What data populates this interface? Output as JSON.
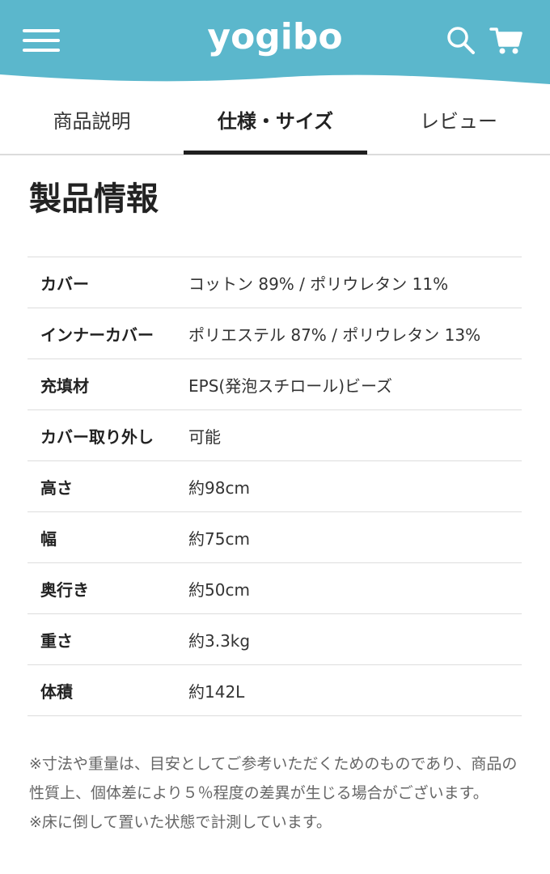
{
  "header": {
    "logo_text": "yogibo",
    "brand_color": "#5bb7cc",
    "icons": [
      "hamburger-menu-icon",
      "search-icon",
      "cart-icon"
    ]
  },
  "tabs": [
    {
      "label": "商品説明",
      "active": false
    },
    {
      "label": "仕様・サイズ",
      "active": true
    },
    {
      "label": "レビュー",
      "active": false
    }
  ],
  "section": {
    "title": "製品情報"
  },
  "specs": [
    {
      "label": "カバー",
      "value": "コットン 89% / ポリウレタン 11%"
    },
    {
      "label": "インナーカバー",
      "value": "ポリエステル 87% / ポリウレタン 13%"
    },
    {
      "label": "充填材",
      "value": "EPS(発泡スチロール)ビーズ"
    },
    {
      "label": "カバー取り外し",
      "value": "可能"
    },
    {
      "label": "高さ",
      "value": "約98cm"
    },
    {
      "label": "幅",
      "value": "約75cm"
    },
    {
      "label": "奥行き",
      "value": "約50cm"
    },
    {
      "label": "重さ",
      "value": "約3.3kg"
    },
    {
      "label": "体積",
      "value": "約142L"
    }
  ],
  "notes": [
    "※寸法や重量は、目安としてご参考いただくためのものであり、商品の性質上、個体差により５％程度の差異が生じる場合がございます。",
    "※床に倒して置いた状態で計測しています。"
  ]
}
